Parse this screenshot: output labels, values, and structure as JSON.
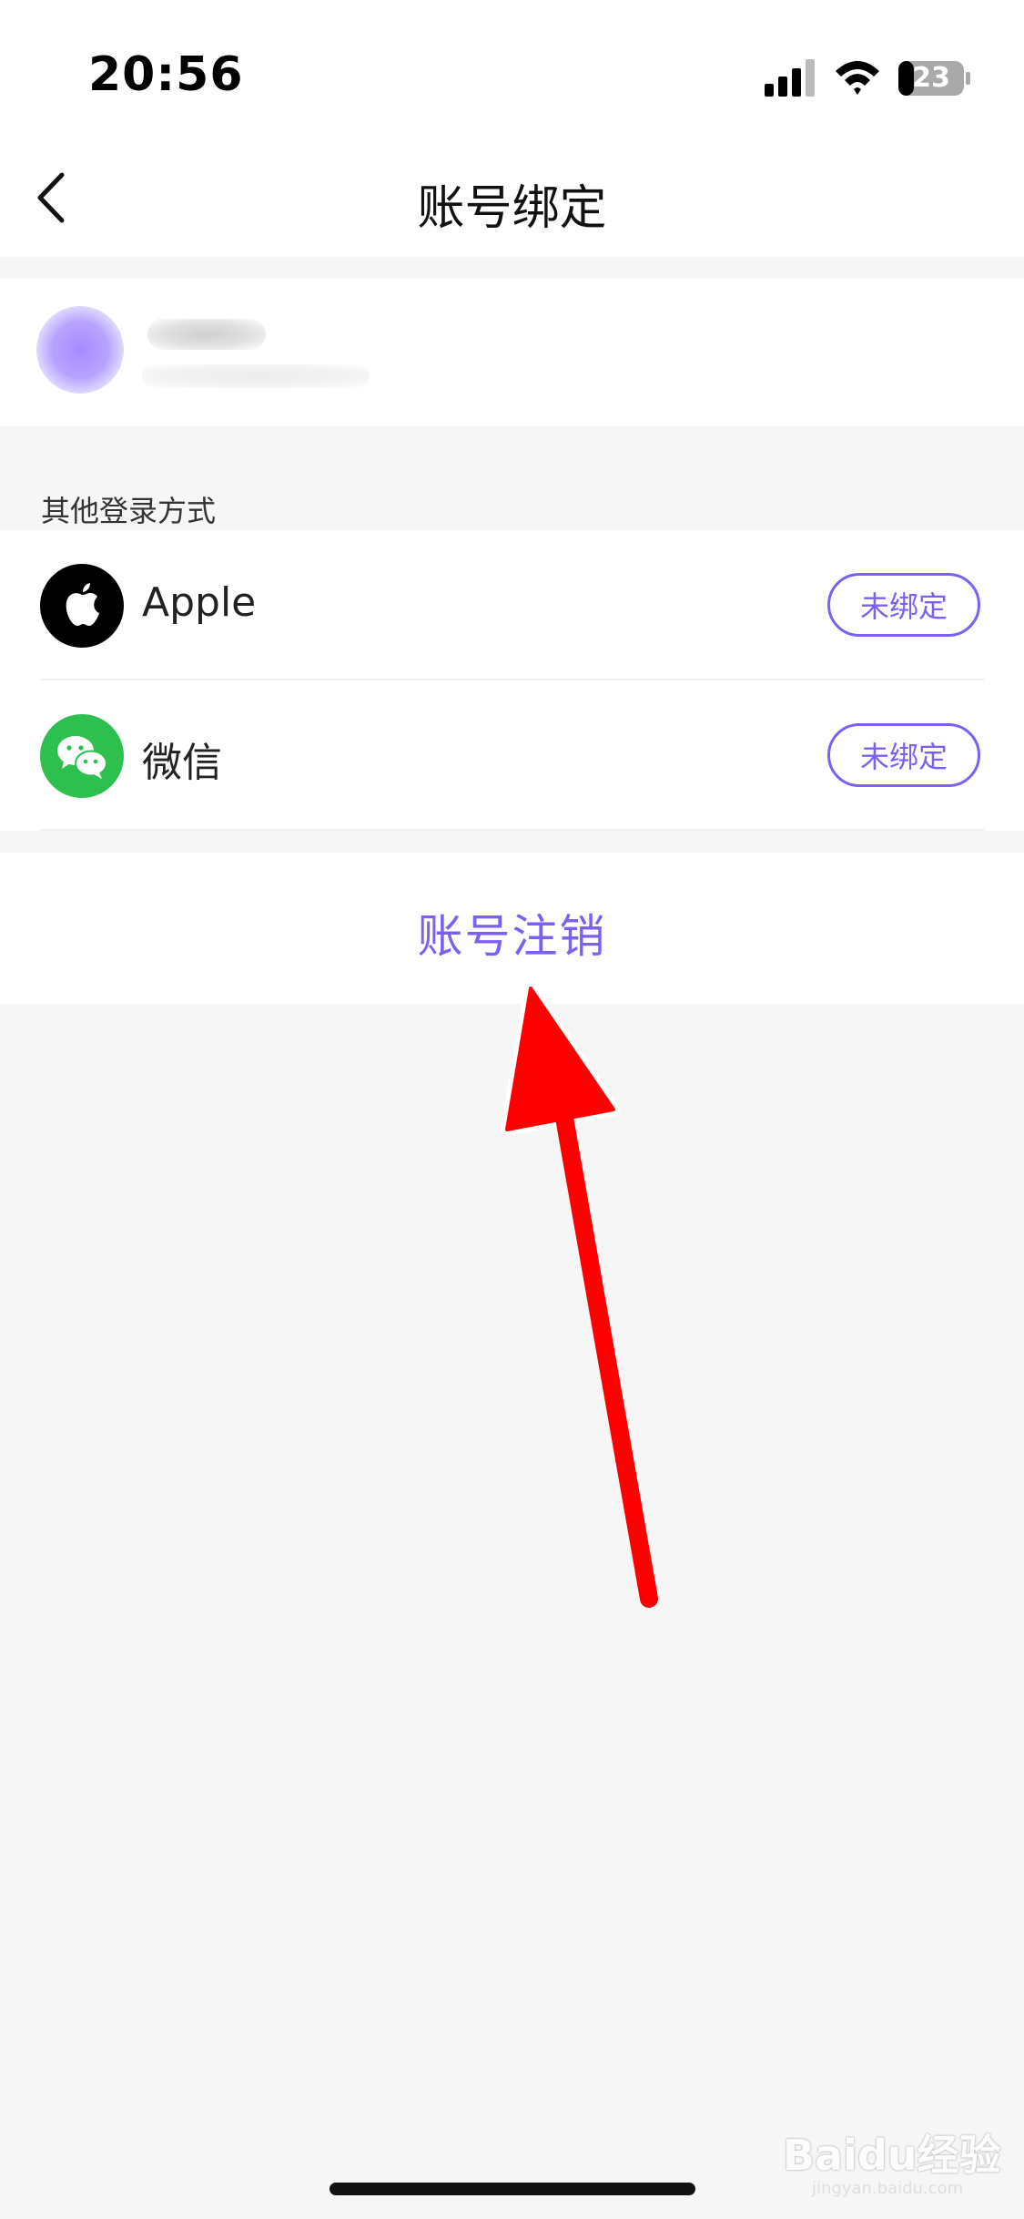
{
  "status_bar": {
    "time": "20:56",
    "battery": "23"
  },
  "nav": {
    "title": "账号绑定",
    "back_icon": "chevron-left-icon"
  },
  "profile": {
    "blurred": true
  },
  "section": {
    "label": "其他登录方式"
  },
  "bindings": [
    {
      "name": "Apple",
      "icon": "apple-icon",
      "status": "未绑定",
      "icon_color": "#000000"
    },
    {
      "name": "微信",
      "icon": "wechat-icon",
      "status": "未绑定",
      "icon_color": "#2ec04e"
    }
  ],
  "deregister": {
    "label": "账号注销"
  },
  "annotation": {
    "icon": "red-arrow-icon",
    "color": "#ff0000"
  },
  "watermark": {
    "text": "Baidu经验",
    "sub": "jingyan.baidu.com"
  },
  "colors": {
    "accent": "#7e5ff5",
    "background": "#f6f6f6"
  }
}
